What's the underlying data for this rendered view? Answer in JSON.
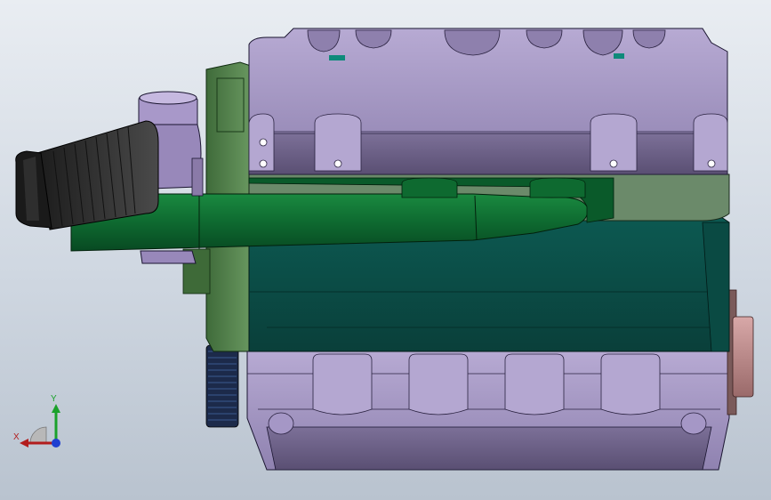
{
  "viewport": {
    "background_top": "#e9edf2",
    "background_bottom": "#b9c3cf"
  },
  "triad": {
    "x_label": "X",
    "y_label": "Y",
    "x_color": "#b21d1d",
    "y_color": "#1aa12b",
    "z_color": "#1f3fd1"
  },
  "model": {
    "description_icon": "engine-model",
    "colors": {
      "block_lavender": "#9d8fbb",
      "block_lavender_dark": "#6e6390",
      "manifold_green": "#0d6a2e",
      "block_teal": "#0f4f47",
      "bracket_green": "#5a8a52",
      "filter_dark": "#2a2a2a",
      "pulley_blue": "#1c2a4a",
      "shaft_pink": "#b98585"
    }
  }
}
